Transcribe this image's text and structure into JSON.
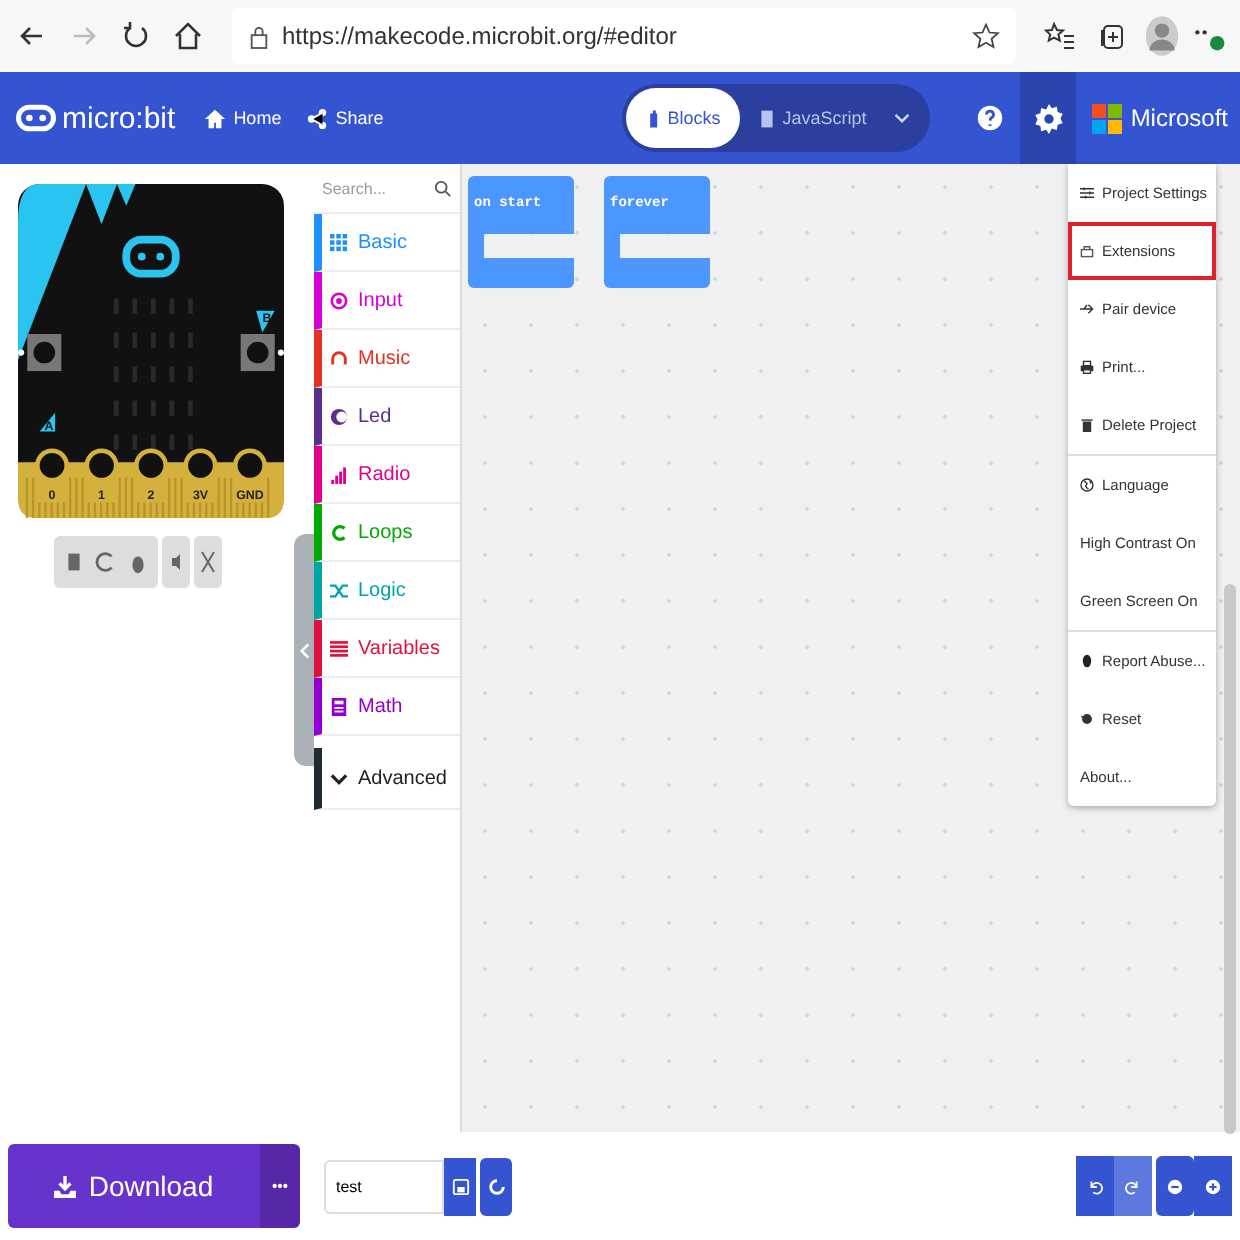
{
  "browser": {
    "url": "https://makecode.microbit.org/#editor",
    "forward_disabled": true
  },
  "header": {
    "brand": "micro:bit",
    "nav": [
      "Home",
      "Share"
    ],
    "editor_tabs": [
      {
        "label": "Blocks",
        "selected": true
      },
      {
        "label": "JavaScript",
        "selected": false
      }
    ],
    "vendor": "Microsoft"
  },
  "simulator": {
    "pins": [
      "0",
      "1",
      "2",
      "3V",
      "GND"
    ],
    "buttons": [
      "A",
      "B"
    ]
  },
  "toolbox": {
    "search": {
      "placeholder": "Search..."
    },
    "categories": [
      {
        "name": "Basic",
        "color": "#1e90ff"
      },
      {
        "name": "Input",
        "color": "#d400d4"
      },
      {
        "name": "Music",
        "color": "#e63022"
      },
      {
        "name": "Led",
        "color": "#5c2d91"
      },
      {
        "name": "Radio",
        "color": "#e3008c"
      },
      {
        "name": "Loops",
        "color": "#00aa00"
      },
      {
        "name": "Logic",
        "color": "#00a4a6"
      },
      {
        "name": "Variables",
        "color": "#dc143c"
      },
      {
        "name": "Math",
        "color": "#9400d3"
      }
    ],
    "advanced": "Advanced"
  },
  "blocks": [
    "on start",
    "forever"
  ],
  "settings_menu": [
    [
      {
        "label": "Project Settings",
        "highlighted": false
      },
      {
        "label": "Extensions",
        "highlighted": true
      },
      {
        "label": "Pair device",
        "highlighted": false
      },
      {
        "label": "Print...",
        "highlighted": false
      },
      {
        "label": "Delete Project",
        "highlighted": false
      }
    ],
    [
      {
        "label": "Language",
        "highlighted": false
      },
      {
        "label": "High Contrast On",
        "highlighted": false
      },
      {
        "label": "Green Screen On",
        "highlighted": false
      }
    ],
    [
      {
        "label": "Report Abuse...",
        "highlighted": false
      },
      {
        "label": "Reset",
        "highlighted": false
      },
      {
        "label": "About...",
        "highlighted": false
      }
    ]
  ],
  "footer": {
    "download": "Download",
    "project_name": "test"
  }
}
